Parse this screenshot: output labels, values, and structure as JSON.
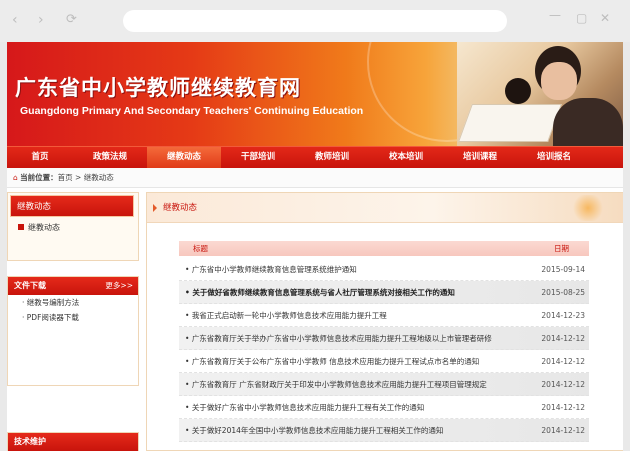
{
  "browser": {
    "nav_back": "‹",
    "nav_forward": "›",
    "nav_reload": "⟳",
    "win_minimize": "—",
    "win_maximize": "▢",
    "win_close": "✕"
  },
  "banner": {
    "title": "广东省中小学教师继续教育网",
    "subtitle": "Guangdong Primary And Secondary Teachers' Continuing Education"
  },
  "nav": {
    "items": [
      "首页",
      "政策法规",
      "继教动态",
      "干部培训",
      "教师培训",
      "校本培训",
      "培训课程",
      "培训报名"
    ],
    "active_index": 2
  },
  "breadcrumb": {
    "label": "当前位置：",
    "home": "首页",
    "sep": " > ",
    "current": "继教动态"
  },
  "sidebar": {
    "section_title": "继教动态",
    "section_item": "继教动态",
    "downloads": {
      "title": "文件下载",
      "more": "更多>>",
      "items": [
        "继教号编制方法",
        "PDF阅读器下载"
      ]
    },
    "tech": {
      "title": "技术维护"
    }
  },
  "main": {
    "title": "继教动态",
    "col_title": "标题",
    "col_date": "日期",
    "rows": [
      {
        "title": "广东省中小学教师继续教育信息管理系统维护通知",
        "date": "2015-09-14"
      },
      {
        "title": "关于做好省教师继续教育信息管理系统与省人社厅管理系统对接相关工作的通知",
        "date": "2015-08-25"
      },
      {
        "title": "我省正式启动新一轮中小学教师信息技术应用能力提升工程",
        "date": "2014-12-23"
      },
      {
        "title": "广东省教育厅关于举办广东省中小学教师信息技术应用能力提升工程地级以上市管理者研修",
        "date": "2014-12-12"
      },
      {
        "title": "广东省教育厅关于公布广东省中小学教师 信息技术应用能力提升工程试点市名单的通知",
        "date": "2014-12-12"
      },
      {
        "title": "广东省教育厅 广东省财政厅关于印发中小学教师信息技术应用能力提升工程项目管理规定",
        "date": "2014-12-12"
      },
      {
        "title": "关于做好广东省中小学教师信息技术应用能力提升工程有关工作的通知",
        "date": "2014-12-12"
      },
      {
        "title": "关于做好2014年全国中小学教师信息技术应用能力提升工程相关工作的通知",
        "date": "2014-12-12"
      }
    ]
  },
  "colors": {
    "brand_red": "#c8140c",
    "banner_orange": "#f07a1a"
  }
}
